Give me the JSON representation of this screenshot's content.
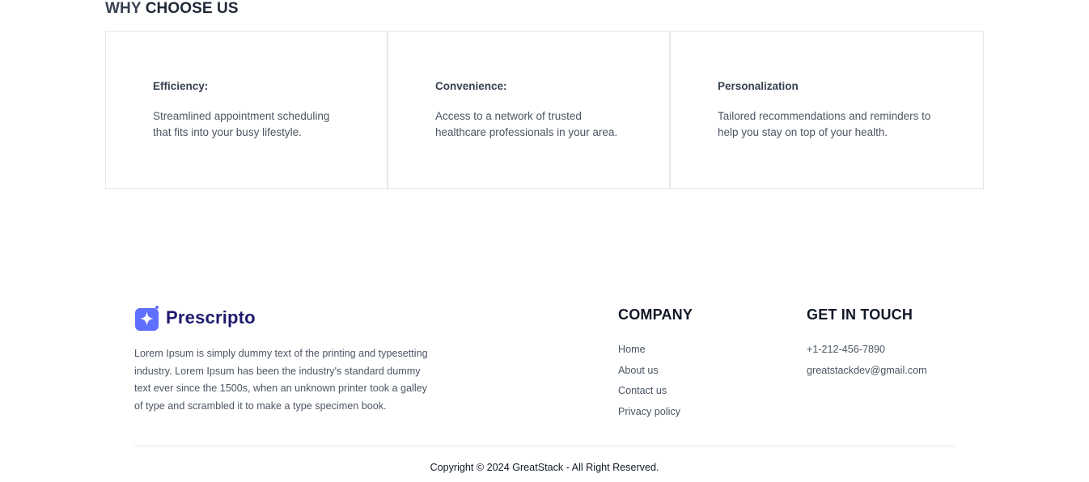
{
  "why_section": {
    "title_prefix": "WHY",
    "title_bold": "CHOOSE US",
    "cards": [
      {
        "title": "Efficiency:",
        "text": "Streamlined appointment scheduling that fits into your busy lifestyle."
      },
      {
        "title": "Convenience:",
        "text": "Access to a network of trusted healthcare professionals in your area."
      },
      {
        "title": "Personalization",
        "text": "Tailored recommendations and reminders to help you stay on top of your health."
      }
    ]
  },
  "footer": {
    "brand": "Prescripto",
    "brand_color": "#1e1b6e",
    "logo_color": "#5f6fff",
    "description": "Lorem Ipsum is simply dummy text of the printing and typesetting industry. Lorem Ipsum has been the industry's standard dummy text ever since the 1500s, when an unknown printer took a galley of type and scrambled it to make a type specimen book.",
    "company": {
      "heading": "COMPANY",
      "links": [
        "Home",
        "About us",
        "Contact us",
        "Privacy policy"
      ]
    },
    "contact": {
      "heading": "GET IN TOUCH",
      "phone": "+1-212-456-7890",
      "email": "greatstackdev@gmail.com"
    },
    "copyright": "Copyright © 2024 GreatStack - All Right Reserved."
  }
}
